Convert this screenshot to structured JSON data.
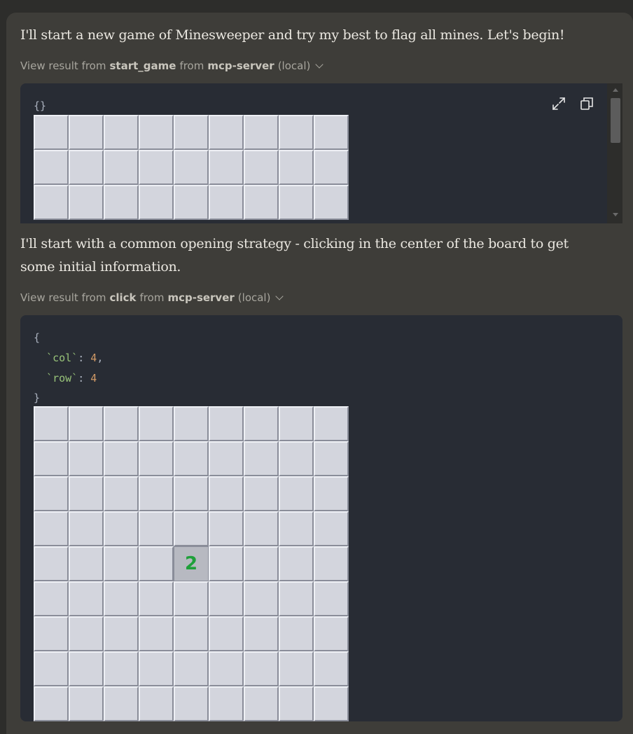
{
  "messages": [
    "I'll start a new game of Minesweeper and try my best to flag all mines. Let's begin!",
    "I'll start with a common opening strategy - clicking in the center of the board to get some initial information."
  ],
  "tool_results": [
    {
      "prefix": "View result from",
      "tool": "start_game",
      "mid": "from",
      "server": "mcp-server",
      "suffix": "(local)"
    },
    {
      "prefix": "View result from",
      "tool": "click",
      "mid": "from",
      "server": "mcp-server",
      "suffix": "(local)"
    }
  ],
  "code1": {
    "args": "{}"
  },
  "code2": {
    "open": "{",
    "col_key": "`col`",
    "col_value": "4",
    "row_key": "`row`",
    "row_value": "4",
    "close": "}"
  },
  "board1": {
    "cols": 9,
    "rows_visible": 3
  },
  "board2": {
    "cols": 9,
    "rows": 9,
    "revealed": {
      "row": 4,
      "col": 4,
      "value": "2"
    }
  },
  "icons": [
    "expand-icon",
    "copy-icon"
  ],
  "colors": {
    "revealed_number": "#1fa03a",
    "code_bg": "#282c34",
    "panel_bg": "#3e3d39"
  }
}
